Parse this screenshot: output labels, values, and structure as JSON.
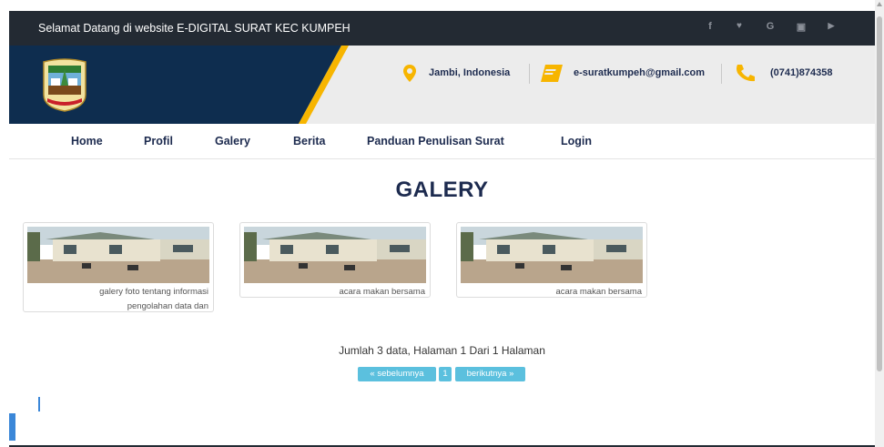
{
  "topbar": {
    "welcome": "Selamat Datang di website E-DIGITAL SURAT KEC KUMPEH",
    "social_icons": [
      "facebook-icon",
      "twitter-icon",
      "google-icon",
      "instagram-icon",
      "youtube-icon"
    ],
    "social_glyphs": [
      "f",
      "♥",
      "G",
      "▣",
      "▶"
    ]
  },
  "header": {
    "location": "Jambi, Indonesia",
    "email": "e-suratkumpeh@gmail.com",
    "phone": "(0741)874358",
    "colors": {
      "navy": "#0e2d4f",
      "accent": "#f7b500",
      "text": "#1d2b4f"
    }
  },
  "nav": {
    "items": [
      "Home",
      "Profil",
      "Galery",
      "Berita",
      "Panduan Penulisan Surat",
      "Login"
    ]
  },
  "main": {
    "title": "GALERY",
    "gallery": [
      {
        "caption_line1": "galery foto tentang informasi",
        "caption_line2": "pengolahan data dan"
      },
      {
        "caption_line1": "acara makan bersama",
        "caption_line2": ""
      },
      {
        "caption_line1": "acara makan bersama",
        "caption_line2": ""
      }
    ],
    "count_text": "Jumlah 3 data, Halaman 1 Dari 1 Halaman",
    "pagination": {
      "prev": "« sebelumnya",
      "page": "1",
      "next": "berikutnya »"
    }
  }
}
